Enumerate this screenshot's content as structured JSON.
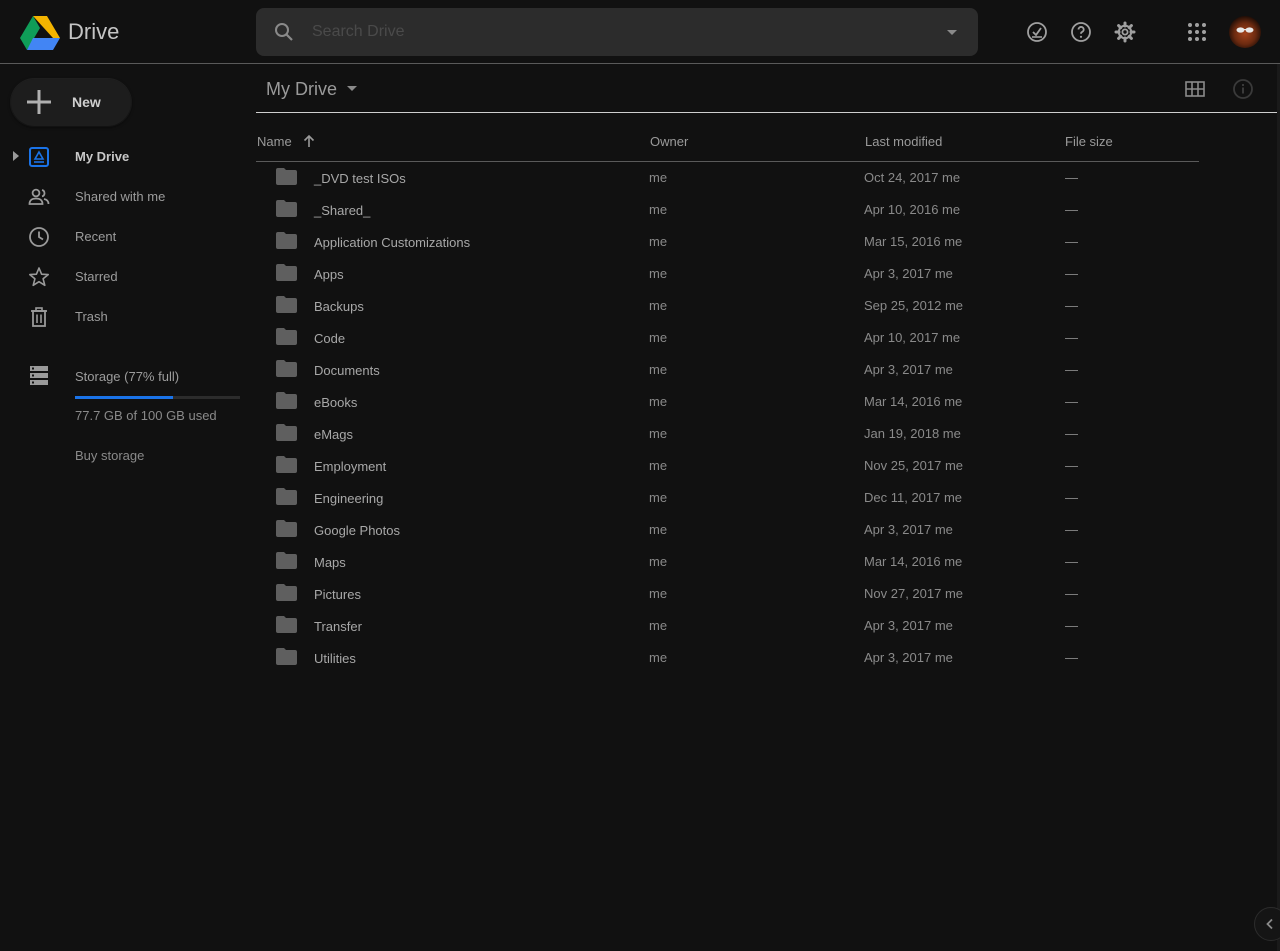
{
  "app": {
    "title": "Drive"
  },
  "search": {
    "placeholder": "Search Drive",
    "value": ""
  },
  "header_icons": [
    "offline-ready-icon",
    "help-icon",
    "settings-icon",
    "apps-grid-icon"
  ],
  "new_button": {
    "label": "New"
  },
  "sidebar": {
    "items": [
      {
        "label": "My Drive",
        "icon": "my-drive-icon",
        "active": true
      },
      {
        "label": "Shared with me",
        "icon": "shared-people-icon",
        "active": false
      },
      {
        "label": "Recent",
        "icon": "clock-icon",
        "active": false
      },
      {
        "label": "Starred",
        "icon": "star-icon",
        "active": false
      },
      {
        "label": "Trash",
        "icon": "trash-icon",
        "active": false
      }
    ],
    "storage": {
      "label": "Storage (77% full)",
      "used_text": "77.7 GB of 100 GB used",
      "fill_fraction": 0.77,
      "buy_label": "Buy storage"
    }
  },
  "toolbar": {
    "crumb": "My Drive"
  },
  "columns": {
    "name": "Name",
    "owner": "Owner",
    "modified": "Last modified",
    "size": "File size"
  },
  "files": [
    {
      "name": "_DVD test ISOs",
      "owner": "me",
      "modified": "Oct 24, 2017  me",
      "size": "—"
    },
    {
      "name": "_Shared_",
      "owner": "me",
      "modified": "Apr 10, 2016  me",
      "size": "—"
    },
    {
      "name": "Application Customizations",
      "owner": "me",
      "modified": "Mar 15, 2016  me",
      "size": "—"
    },
    {
      "name": "Apps",
      "owner": "me",
      "modified": "Apr 3, 2017  me",
      "size": "—"
    },
    {
      "name": "Backups",
      "owner": "me",
      "modified": "Sep 25, 2012  me",
      "size": "—"
    },
    {
      "name": "Code",
      "owner": "me",
      "modified": "Apr 10, 2017  me",
      "size": "—"
    },
    {
      "name": "Documents",
      "owner": "me",
      "modified": "Apr 3, 2017  me",
      "size": "—"
    },
    {
      "name": "eBooks",
      "owner": "me",
      "modified": "Mar 14, 2016  me",
      "size": "—"
    },
    {
      "name": "eMags",
      "owner": "me",
      "modified": "Jan 19, 2018  me",
      "size": "—"
    },
    {
      "name": "Employment",
      "owner": "me",
      "modified": "Nov 25, 2017  me",
      "size": "—"
    },
    {
      "name": "Engineering",
      "owner": "me",
      "modified": "Dec 11, 2017  me",
      "size": "—"
    },
    {
      "name": "Google Photos",
      "owner": "me",
      "modified": "Apr 3, 2017  me",
      "size": "—"
    },
    {
      "name": "Maps",
      "owner": "me",
      "modified": "Mar 14, 2016  me",
      "size": "—"
    },
    {
      "name": "Pictures",
      "owner": "me",
      "modified": "Nov 27, 2017  me",
      "size": "—"
    },
    {
      "name": "Transfer",
      "owner": "me",
      "modified": "Apr 3, 2017  me",
      "size": "—"
    },
    {
      "name": "Utilities",
      "owner": "me",
      "modified": "Apr 3, 2017  me",
      "size": "—"
    }
  ],
  "colors": {
    "background": "#111111",
    "accent": "#1a73e8",
    "folder": "#5f5f5f",
    "text": "#a8a8a8",
    "logo_green": "#0f9d58",
    "logo_yellow": "#f4b400",
    "logo_blue": "#4285f4"
  }
}
